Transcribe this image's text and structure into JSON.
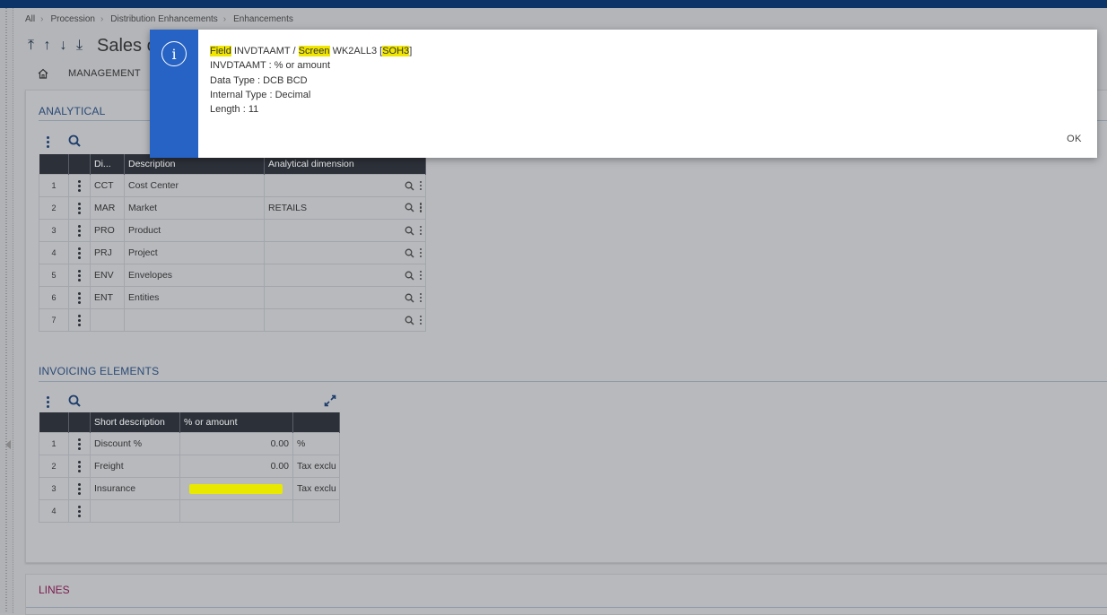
{
  "breadcrumb": [
    "All",
    "Procession",
    "Distribution Enhancements",
    "Enhancements"
  ],
  "title_row": {
    "title": "Sales o"
  },
  "menubar": {
    "tab": "MANAGEMENT"
  },
  "analytical": {
    "title": "ANALYTICAL",
    "columns": [
      "Di...",
      "Description",
      "Analytical dimension"
    ],
    "rows": [
      {
        "n": "1",
        "code": "CCT",
        "desc": "Cost Center",
        "dim": ""
      },
      {
        "n": "2",
        "code": "MAR",
        "desc": "Market",
        "dim": "RETAILS"
      },
      {
        "n": "3",
        "code": "PRO",
        "desc": "Product",
        "dim": ""
      },
      {
        "n": "4",
        "code": "PRJ",
        "desc": "Project",
        "dim": ""
      },
      {
        "n": "5",
        "code": "ENV",
        "desc": "Envelopes",
        "dim": ""
      },
      {
        "n": "6",
        "code": "ENT",
        "desc": "Entities",
        "dim": ""
      },
      {
        "n": "7",
        "code": "",
        "desc": "",
        "dim": ""
      }
    ]
  },
  "invoicing": {
    "title": "INVOICING ELEMENTS",
    "columns": [
      "Short description",
      "% or amount",
      ""
    ],
    "rows": [
      {
        "n": "1",
        "desc": "Discount %",
        "amount": "0.00",
        "type": "%"
      },
      {
        "n": "2",
        "desc": "Freight",
        "amount": "0.00",
        "type": "Tax exclu"
      },
      {
        "n": "3",
        "desc": "Insurance",
        "amount": "",
        "type": "Tax exclu"
      },
      {
        "n": "4",
        "desc": "",
        "amount": "",
        "type": ""
      }
    ]
  },
  "lines": {
    "title": "LINES"
  },
  "dialog": {
    "field_label": "Field",
    "field_name": "INVDTAAMT",
    "slash": "/",
    "screen_label": "Screen",
    "screen_name": "WK2ALL3",
    "screen_code": "SOH3",
    "line2": "INVDTAAMT : % or amount",
    "line3": "Data Type : DCB BCD",
    "line4": "Internal Type : Decimal",
    "line5": "Length : 11",
    "ok": "OK"
  },
  "colors": {
    "topbar": "#0b3568",
    "dialog_stripe": "#2763c4",
    "highlight": "#f0e600",
    "section_title": "#2b4a75",
    "lines_title": "#7a1a4c"
  }
}
